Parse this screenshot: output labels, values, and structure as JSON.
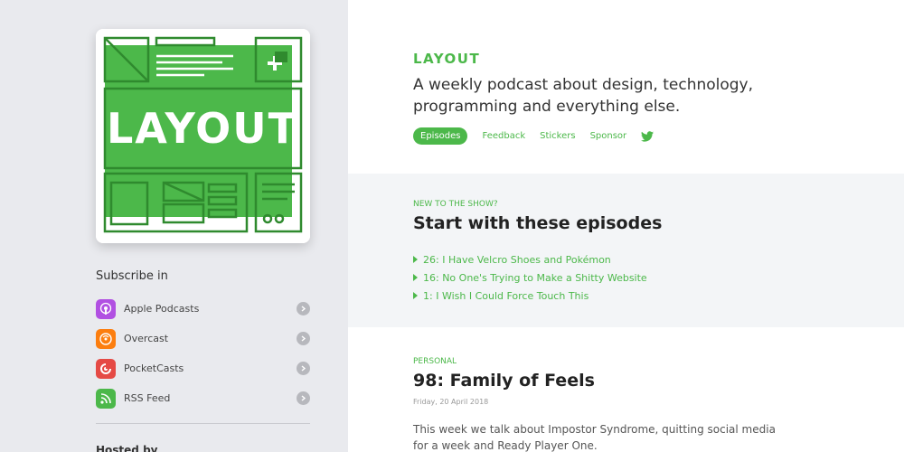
{
  "sidebar": {
    "cover": {
      "logo_text": "LAYOUT",
      "accent_color": "#4cb84a",
      "icon": "layout-logo"
    },
    "subscribe_title": "Subscribe in",
    "subscribe_items": [
      {
        "label": "Apple Podcasts",
        "icon": "apple-podcasts-icon",
        "color": "#b150e2"
      },
      {
        "label": "Overcast",
        "icon": "overcast-icon",
        "color": "#fc7e0f"
      },
      {
        "label": "PocketCasts",
        "icon": "pocketcasts-icon",
        "color": "#e54a45"
      },
      {
        "label": "RSS Feed",
        "icon": "rss-icon",
        "color": "#4cb84a"
      }
    ],
    "hosted_by": "Hosted by"
  },
  "header": {
    "show_name": "LAYOUT",
    "tagline": "A weekly podcast about design, technology, programming and everything else."
  },
  "nav": {
    "items": [
      "Episodes",
      "Feedback",
      "Stickers",
      "Sponsor"
    ],
    "active": "Episodes",
    "social_icon": "twitter-icon"
  },
  "new_to_show": {
    "eyebrow": "NEW TO THE SHOW?",
    "title": "Start with these episodes",
    "episodes": [
      "26: I Have Velcro Shoes and Pokémon",
      "16: No One's Trying to Make a Shitty Website",
      "1: I Wish I Could Force Touch This"
    ]
  },
  "latest_post": {
    "category": "PERSONAL",
    "title": "98: Family of Feels",
    "date": "Friday, 20 April 2018",
    "excerpt": "This week we talk about Impostor Syndrome, quitting social media for a week and Ready Player One."
  },
  "colors": {
    "accent": "#4cb84a",
    "sidebar_bg": "#e9eaee",
    "panel_bg": "#f3f5f7"
  }
}
